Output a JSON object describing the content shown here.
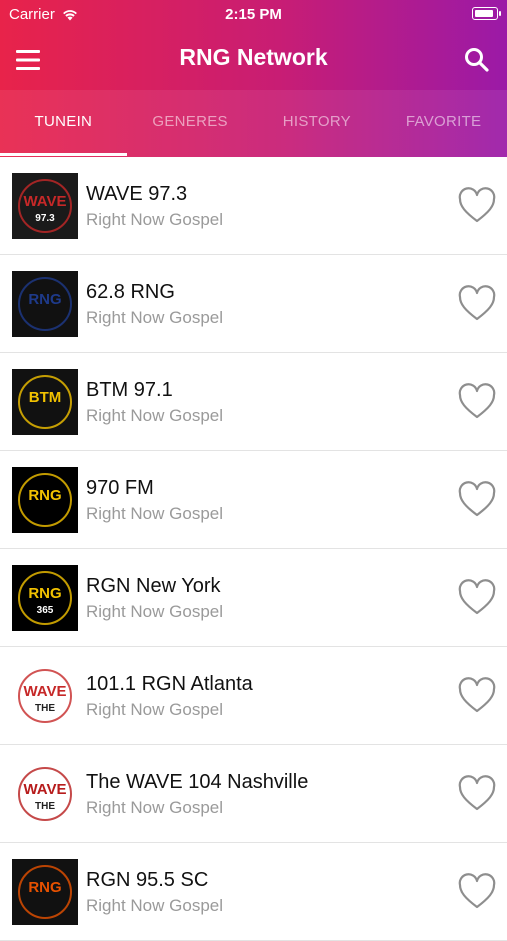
{
  "status_bar": {
    "carrier": "Carrier",
    "time": "2:15 PM",
    "battery_level": 1.0
  },
  "app": {
    "title": "RNG Network"
  },
  "icons": {
    "menu": "menu-icon",
    "search": "search-icon",
    "favorite": "heart-outline-icon",
    "wifi": "wifi-icon"
  },
  "colors": {
    "gradient_start": "#e8234a",
    "gradient_end": "#9b1aa7",
    "subtitle": "#9a9a9a"
  },
  "tabs": [
    {
      "label": "TUNEIN",
      "active": true
    },
    {
      "label": "GENERES",
      "active": false
    },
    {
      "label": "HISTORY",
      "active": false
    },
    {
      "label": "FAVORITE",
      "active": false
    }
  ],
  "stations": [
    {
      "name": "WAVE 97.3",
      "subtitle": "Right Now Gospel",
      "logo_text": "WAVE",
      "logo_sub": "97.3"
    },
    {
      "name": "62.8 RNG",
      "subtitle": "Right Now Gospel",
      "logo_text": "RNG",
      "logo_sub": ""
    },
    {
      "name": "BTM 97.1",
      "subtitle": "Right Now Gospel",
      "logo_text": "BTM",
      "logo_sub": ""
    },
    {
      "name": "970 FM",
      "subtitle": "Right Now Gospel",
      "logo_text": "RNG",
      "logo_sub": ""
    },
    {
      "name": "RGN New York",
      "subtitle": "Right Now Gospel",
      "logo_text": "RNG",
      "logo_sub": "365"
    },
    {
      "name": "101.1 RGN Atlanta",
      "subtitle": "Right Now Gospel",
      "logo_text": "WAVE",
      "logo_sub": "THE"
    },
    {
      "name": "The WAVE 104 Nashville",
      "subtitle": "Right Now Gospel",
      "logo_text": "WAVE",
      "logo_sub": "THE"
    },
    {
      "name": "RGN 95.5 SC",
      "subtitle": "Right Now Gospel",
      "logo_text": "RNG",
      "logo_sub": ""
    }
  ]
}
